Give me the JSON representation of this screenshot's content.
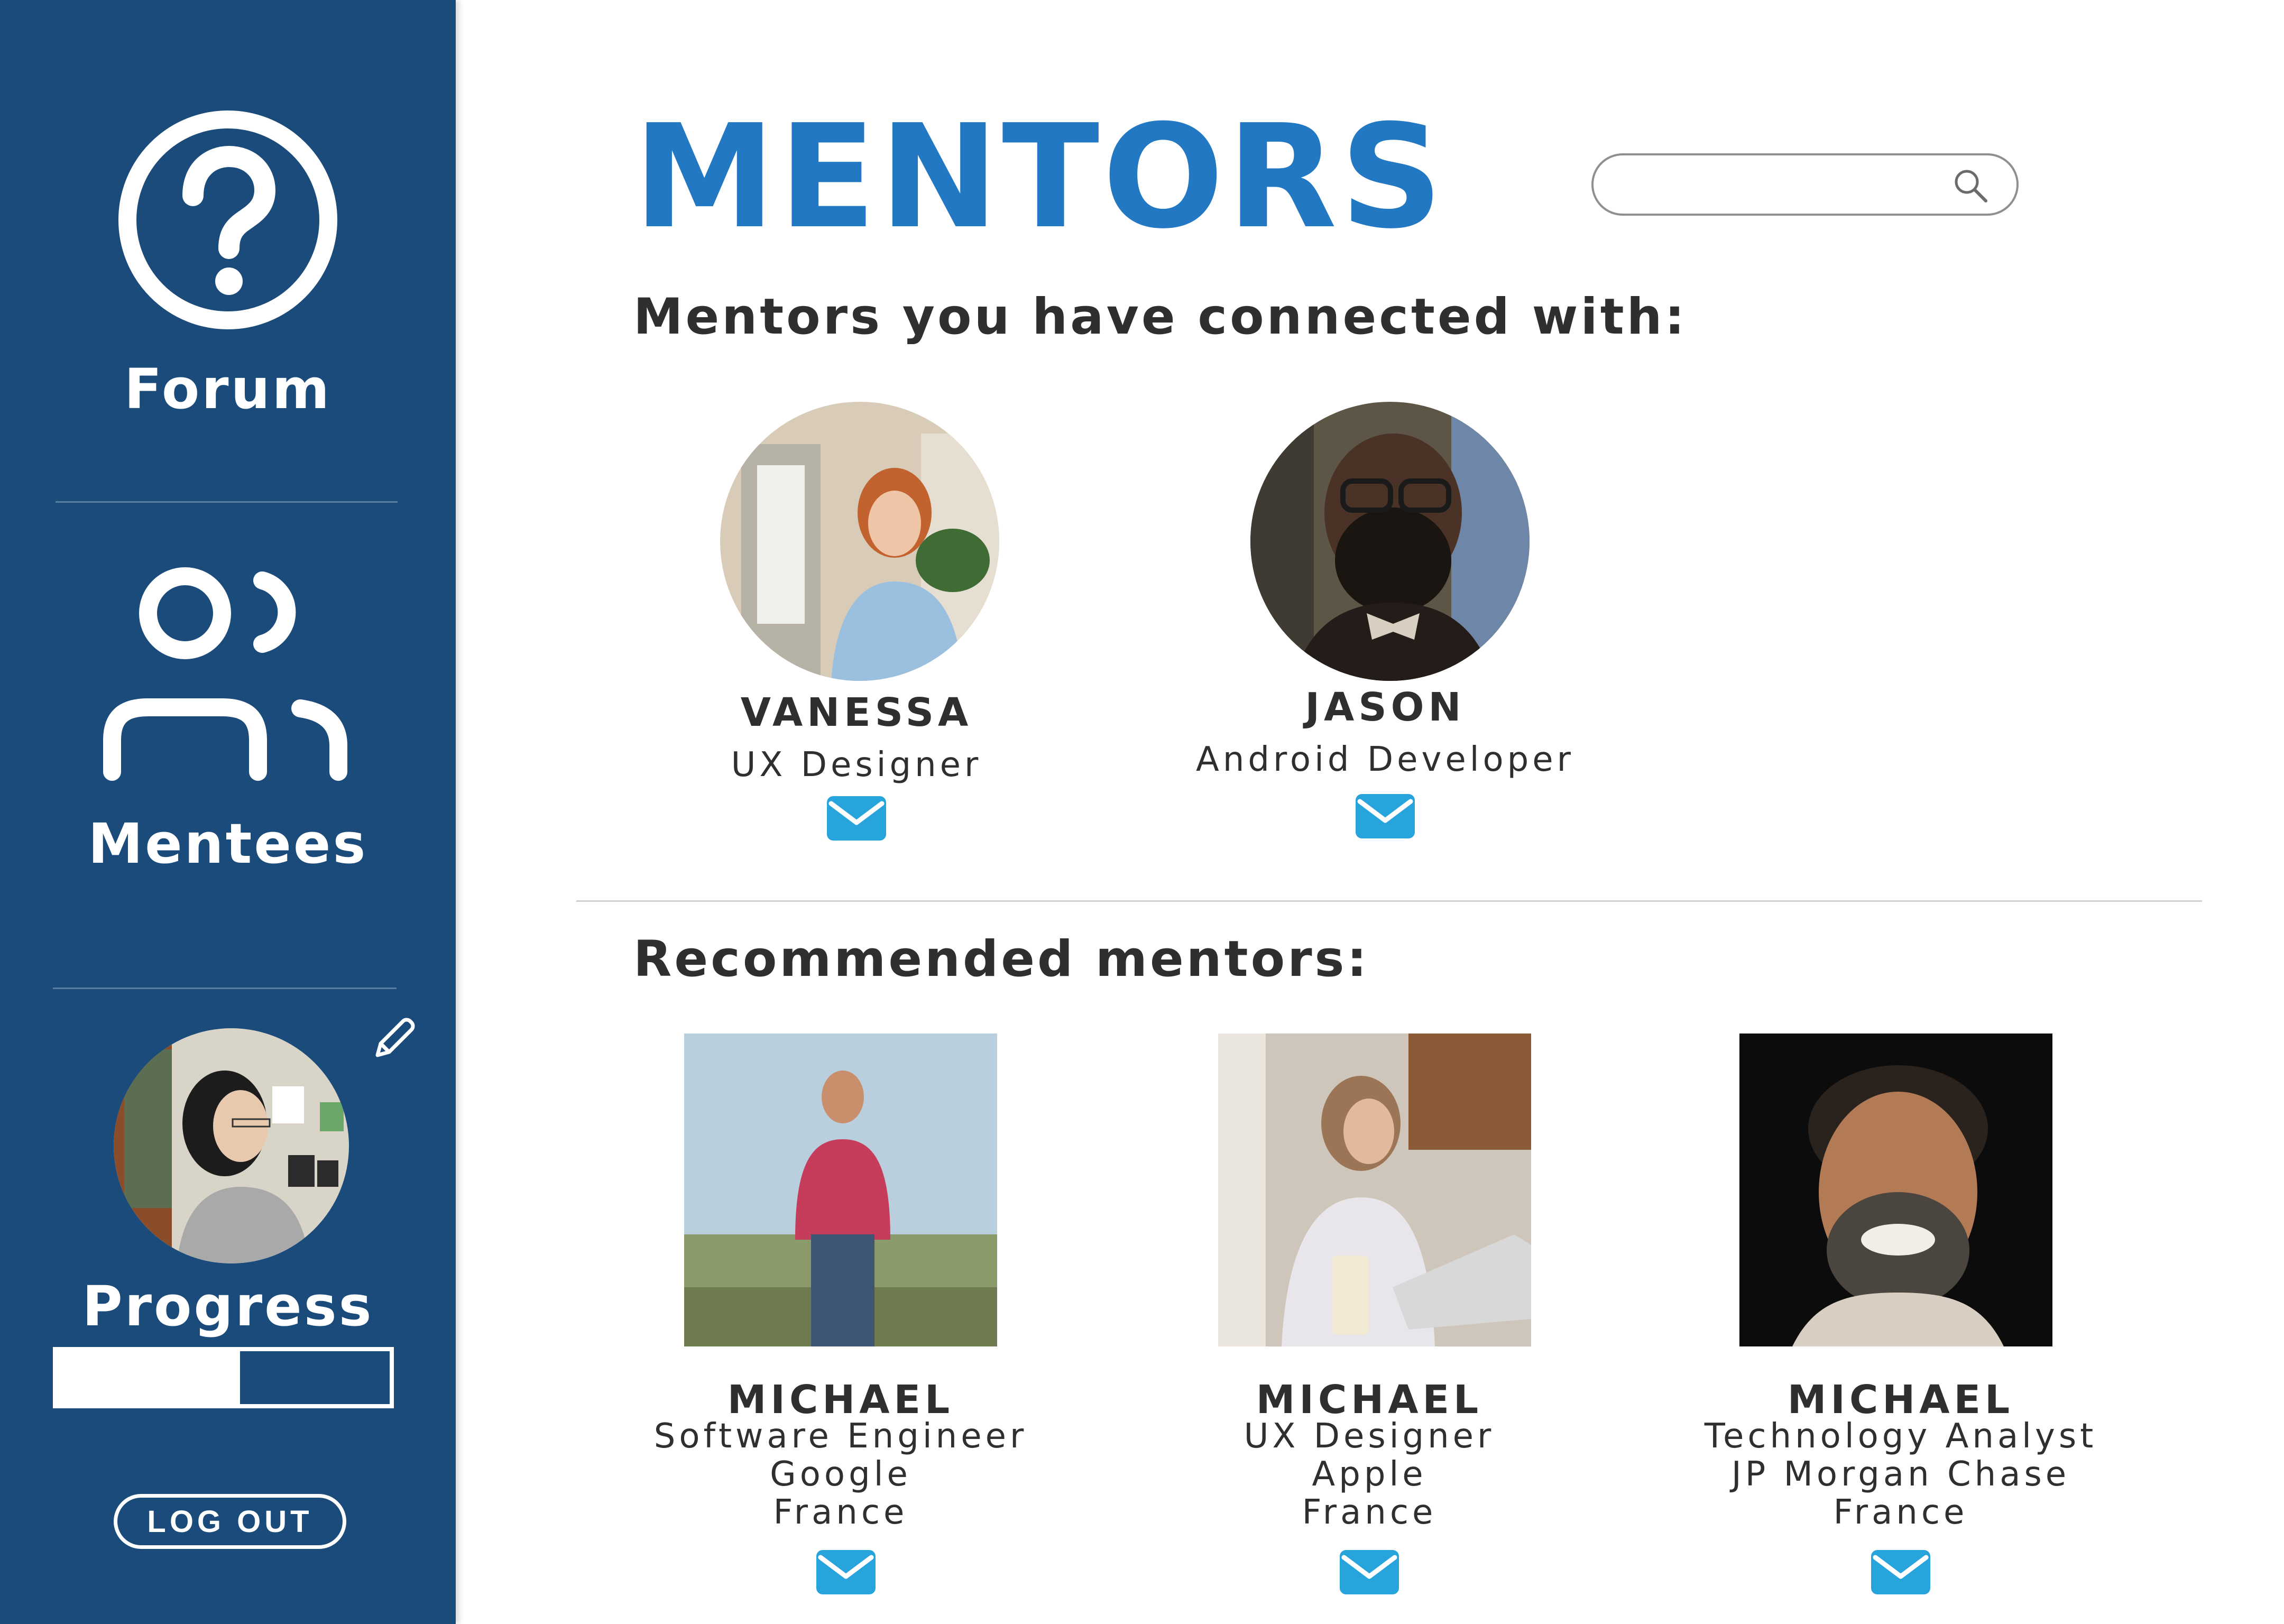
{
  "colors": {
    "sidebar_bg": "#1a4b7b",
    "title_blue": "#2278c2",
    "mail_blue": "#27a4dc",
    "text_dark": "#2f2f2f"
  },
  "sidebar": {
    "forum_label": "Forum",
    "forum_icon": "question-circle-icon",
    "mentees_label": "Mentees",
    "mentees_icon": "users-icon",
    "progress_label": "Progress",
    "progress_value": 0.55,
    "edit_icon": "pencil-icon",
    "logout_label": "LOG OUT"
  },
  "main": {
    "title": "MENTORS",
    "search": {
      "placeholder": "",
      "icon": "search-icon"
    },
    "connected_heading": "Mentors you have connected with:",
    "connected": [
      {
        "name": "VANESSA",
        "role": "UX Designer",
        "icon": "mail-icon"
      },
      {
        "name": "JASON",
        "role": "Android Developer",
        "icon": "mail-icon"
      }
    ],
    "recommended_heading": "Recommended mentors:",
    "recommended": [
      {
        "name": "MICHAEL",
        "role": "Software Engineer",
        "company": "Google",
        "country": "France",
        "icon": "mail-icon"
      },
      {
        "name": "MICHAEL",
        "role": "UX Designer",
        "company": "Apple",
        "country": "France",
        "icon": "mail-icon"
      },
      {
        "name": "MICHAEL",
        "role": "Technology Analyst",
        "company": "JP Morgan Chase",
        "country": "France",
        "icon": "mail-icon"
      }
    ]
  }
}
